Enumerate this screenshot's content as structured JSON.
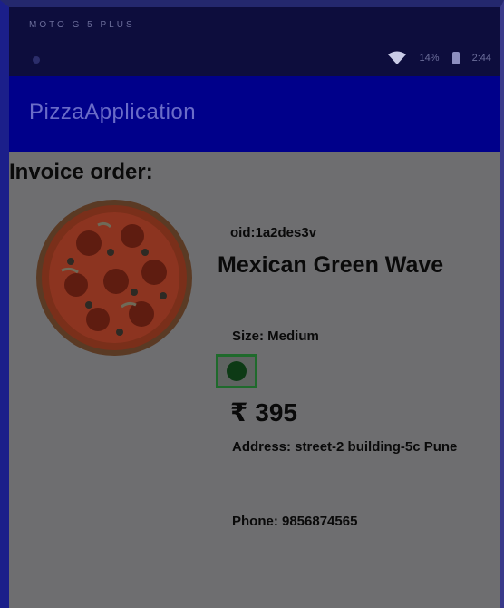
{
  "status_bar": {
    "carrier": "MOTO G 5 PLUS",
    "battery_text": "14%",
    "time": "2:44"
  },
  "app_bar": {
    "title": "PizzaApplication"
  },
  "invoice": {
    "heading": "Invoice order:",
    "order_id": "oid:1a2des3v",
    "pizza_name": "Mexican Green Wave",
    "size": "Size: Medium",
    "veg_indicator": "veg-mark-icon",
    "price": "₹ 395",
    "address": "Address: street-2 building-5c Pune",
    "phone": "Phone: 9856874565"
  },
  "colors": {
    "app_bar": "#00008a",
    "status_bar": "#0d0d3d",
    "background": "#6e6e70",
    "veg_green": "#1f6a2c"
  }
}
